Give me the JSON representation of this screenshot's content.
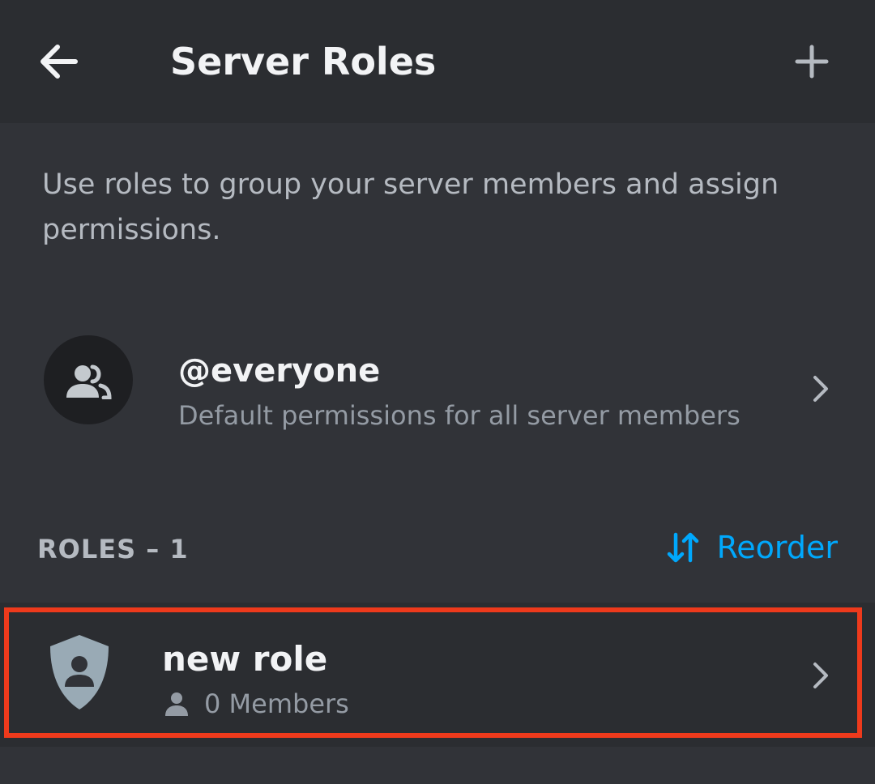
{
  "header": {
    "title": "Server Roles",
    "back_icon": "arrow-left-icon",
    "add_icon": "plus-icon"
  },
  "description": "Use roles to group your server members and assign permissions.",
  "everyone": {
    "name": "@everyone",
    "subtitle": "Default permissions for all server members",
    "icon": "people-icon"
  },
  "roles_section": {
    "header": "ROLES – 1",
    "reorder_label": "Reorder",
    "reorder_icon": "sort-arrows-icon"
  },
  "roles": [
    {
      "name": "new role",
      "members": "0 Members",
      "icon": "shield-person-icon"
    }
  ],
  "colors": {
    "background": "#313338",
    "header_bg": "#2b2d31",
    "accent_link": "#00a8fc",
    "highlight_border": "#ee3a1c",
    "role_icon": "#99aab5"
  }
}
